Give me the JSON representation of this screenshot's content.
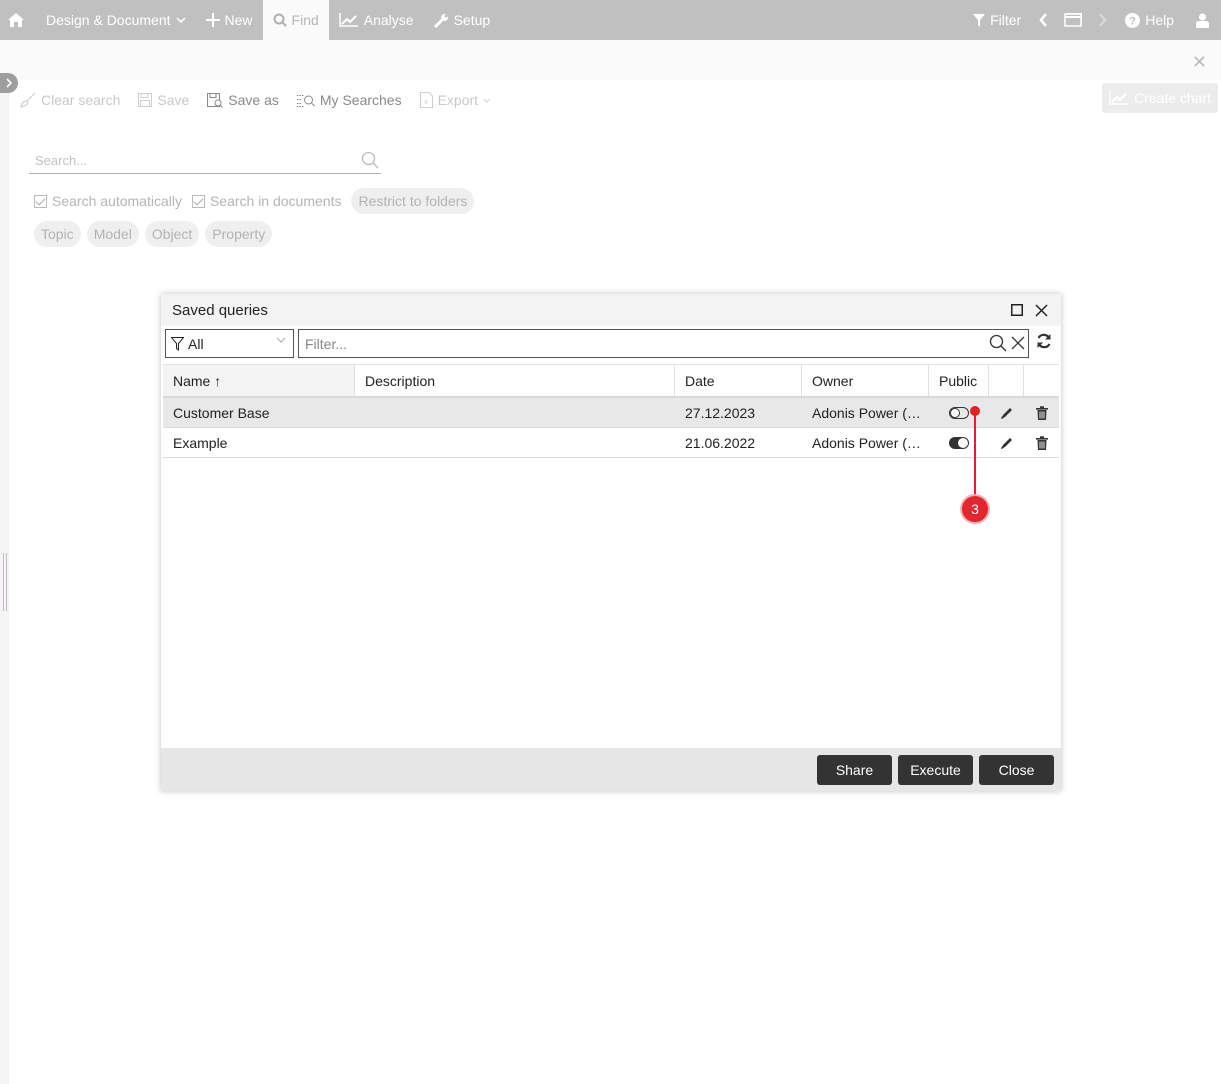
{
  "topbar": {
    "home_icon": "home-icon",
    "items": [
      {
        "label": "Design & Document",
        "icon": "chevron-down-icon"
      },
      {
        "label": "New",
        "icon": "plus-icon"
      },
      {
        "label": "Find",
        "icon": "search-icon",
        "active": true
      },
      {
        "label": "Analyse",
        "icon": "chart-line-icon"
      },
      {
        "label": "Setup",
        "icon": "wrench-icon"
      }
    ],
    "right": {
      "filter_label": "Filter",
      "help_label": "Help"
    }
  },
  "toolbar": {
    "clear_search": "Clear search",
    "save": "Save",
    "save_as": "Save as",
    "my_searches": "My Searches",
    "export": "Export",
    "create_chart": "Create chart"
  },
  "search": {
    "placeholder": "Search...",
    "search_automatically": "Search automatically",
    "search_in_documents": "Search in documents",
    "restrict_to_folders": "Restrict to folders",
    "chips": [
      "Topic",
      "Model",
      "Object",
      "Property"
    ]
  },
  "dialog": {
    "title": "Saved queries",
    "filter_select": "All",
    "filter_placeholder": "Filter...",
    "columns": [
      "Name ↑",
      "Description",
      "Date",
      "Owner",
      "Public"
    ],
    "rows": [
      {
        "name": "Customer Base",
        "description": "",
        "date": "27.12.2023",
        "owner": "Adonis Power (…",
        "public": false
      },
      {
        "name": "Example",
        "description": "",
        "date": "21.06.2022",
        "owner": "Adonis Power (…",
        "public": true
      }
    ],
    "buttons": {
      "share": "Share",
      "execute": "Execute",
      "close": "Close"
    }
  },
  "callout": {
    "number": "3",
    "color": "#e32530"
  }
}
